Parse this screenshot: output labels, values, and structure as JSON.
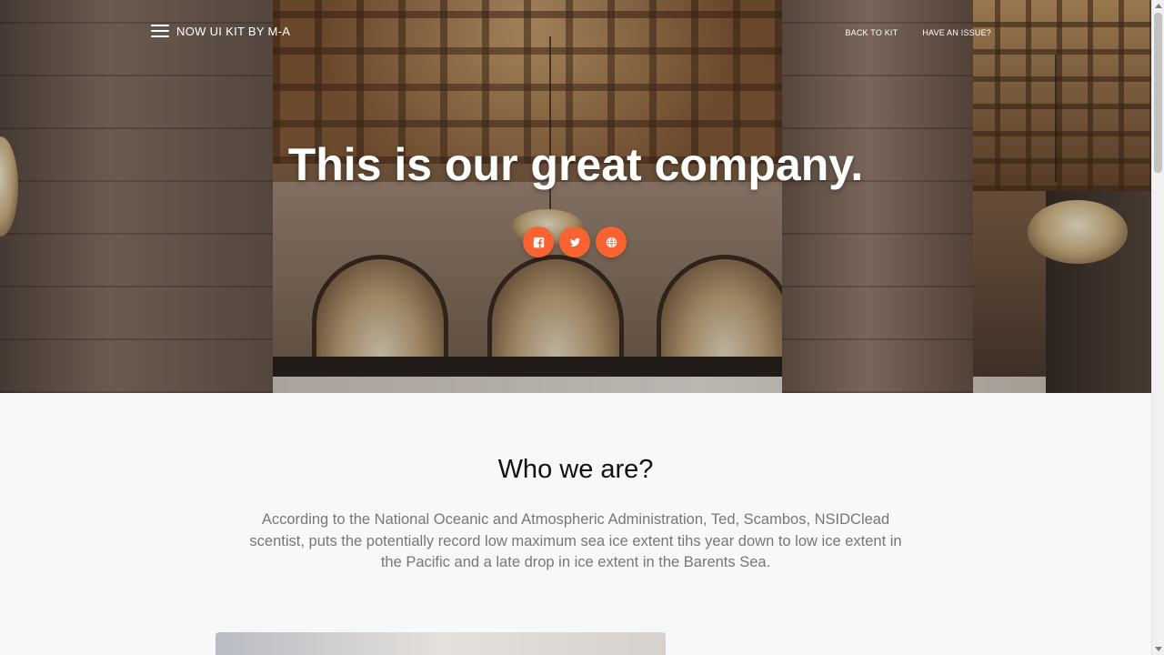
{
  "nav": {
    "brand": "NOW UI KIT BY M-A",
    "links": [
      "BACK TO KIT",
      "HAVE AN ISSUE?"
    ]
  },
  "hero": {
    "title": "This is our great company.",
    "socials": [
      {
        "icon": "facebook-icon"
      },
      {
        "icon": "twitter-icon"
      },
      {
        "icon": "globe-icon"
      }
    ]
  },
  "about": {
    "title": "Who we are?",
    "description": "According to the National Oceanic and Atmospheric Administration, Ted, Scambos, NSIDClead scentist, puts the potentially record low maximum sea ice extent tihs year down to low ice extent in the Pacific and a late drop in ice extent in the Barents Sea."
  },
  "colors": {
    "accent": "#f96332",
    "text_muted": "#777777",
    "background": "#f7f8fa"
  }
}
